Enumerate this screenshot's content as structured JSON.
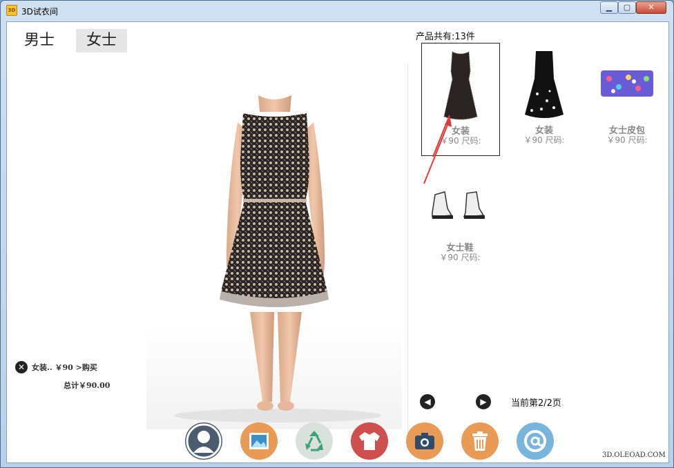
{
  "window": {
    "title": "3D试衣间",
    "app_icon_text": "3D",
    "min": "▁",
    "max": "▢",
    "close": "✕"
  },
  "tabs": {
    "men": "男士",
    "women": "女士"
  },
  "cart": {
    "remove": "✕",
    "line": "女装.. ￥90 >购买",
    "total": "总计￥90.00"
  },
  "products": {
    "count_text": "产品共有:13件",
    "items": [
      {
        "name": "女装",
        "price": "￥90 尺码:",
        "icon": "lace-dress-icon"
      },
      {
        "name": "女装",
        "price": "￥90 尺码:",
        "icon": "floral-dress-icon"
      },
      {
        "name": "女士皮包",
        "price": "￥90 尺码:",
        "icon": "sequin-clutch-icon"
      },
      {
        "name": "女士鞋",
        "price": "￥90 尺码:",
        "icon": "sneakers-icon"
      }
    ],
    "selected_index": 0
  },
  "pager": {
    "prev": "◀",
    "next": "▶",
    "info": "当前第2/2页"
  },
  "toolbar": {
    "items": [
      "user-icon",
      "image-icon",
      "recycle-icon",
      "shirt-icon",
      "camera-icon",
      "trash-icon",
      "at-icon"
    ],
    "colors": [
      "#4b5b70",
      "#e99a55",
      "#d9e1dc",
      "#cf4e4e",
      "#e99a55",
      "#e99a55",
      "#79b4da"
    ]
  },
  "watermark": "3D.OLEOAD.COM"
}
